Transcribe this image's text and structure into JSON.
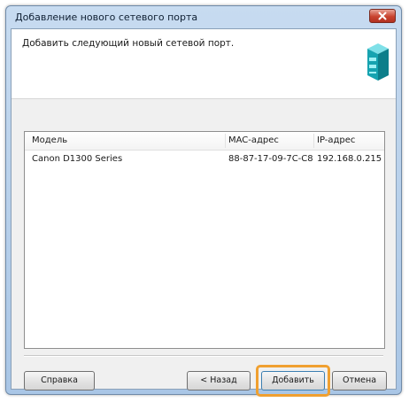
{
  "window": {
    "title": "Добавление нового сетевого порта"
  },
  "header": {
    "text": "Добавить следующий новый сетевой порт."
  },
  "table": {
    "columns": [
      "Модель",
      "MAC-адрес",
      "IP-адрес"
    ],
    "rows": [
      [
        "Canon D1300 Series",
        "88-87-17-09-7C-C8",
        "192.168.0.215"
      ]
    ]
  },
  "buttons": {
    "help": "Справка",
    "back": "< Назад",
    "add": "Добавить",
    "cancel": "Отмена"
  },
  "icons": {
    "close": "close-icon",
    "port": "network-port-icon"
  },
  "colors": {
    "highlight": "#f0a030"
  }
}
